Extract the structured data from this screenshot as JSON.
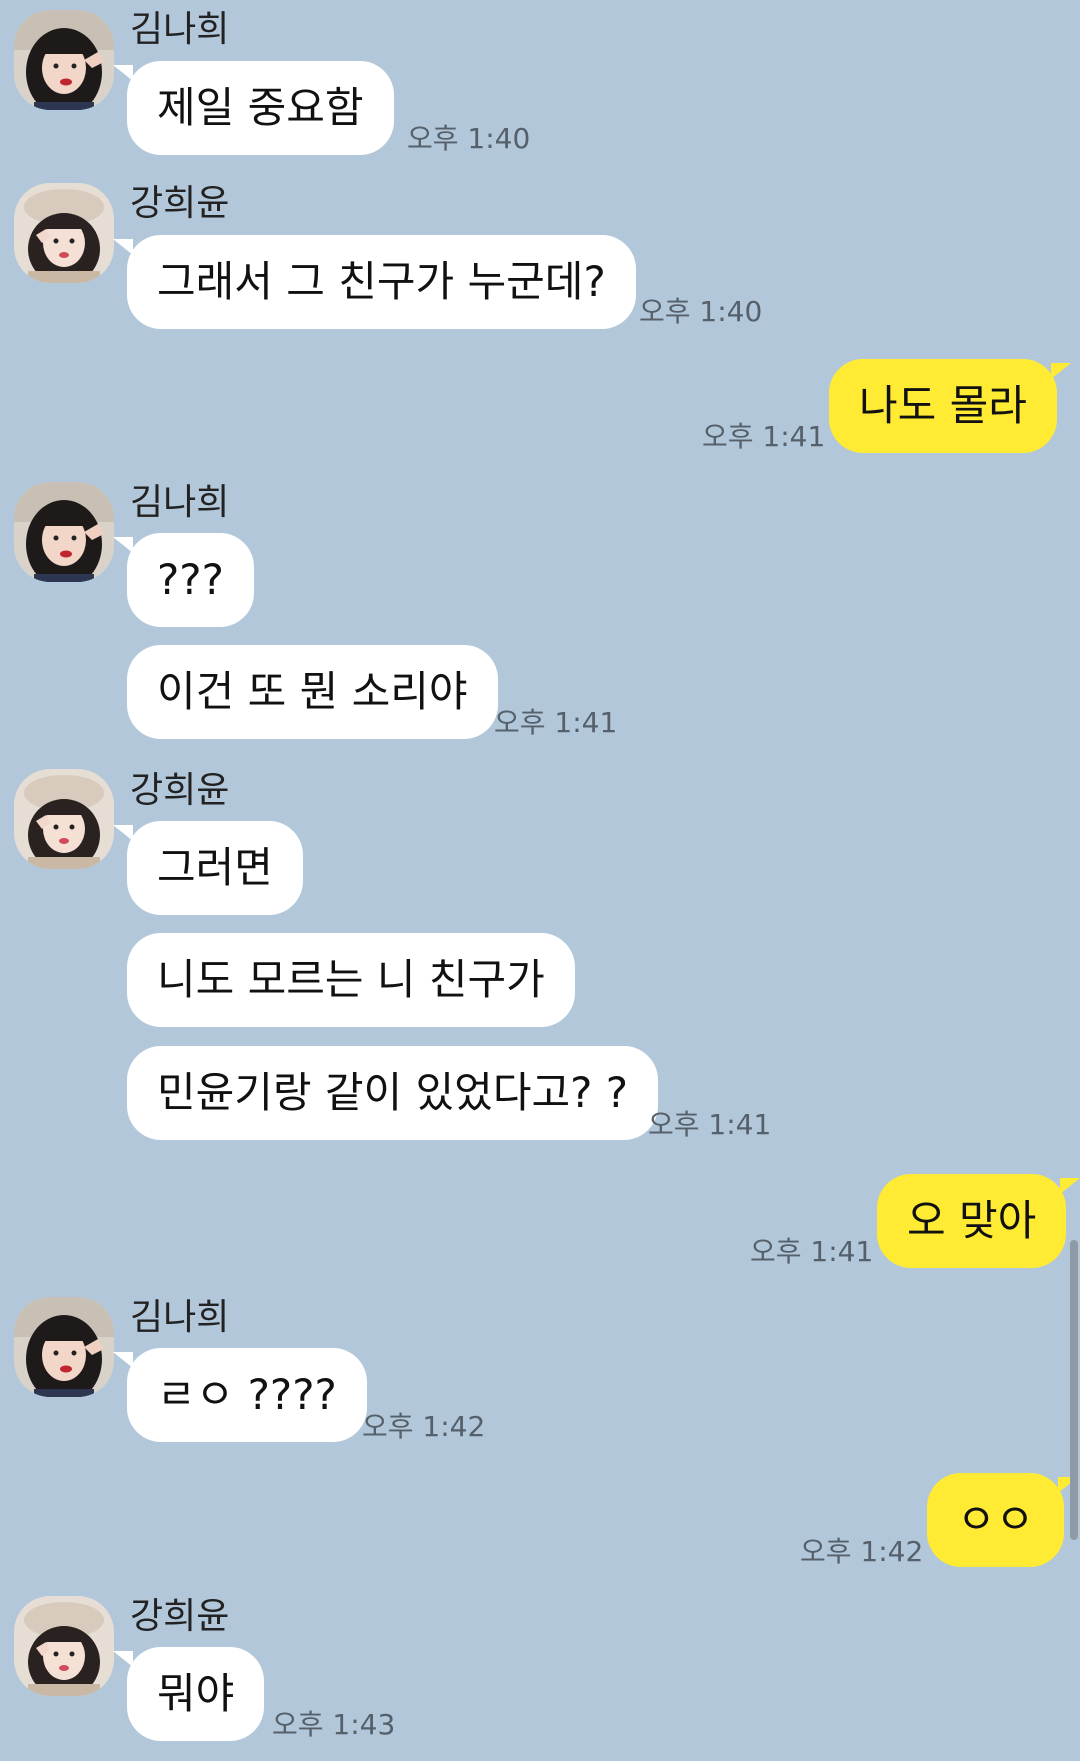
{
  "participants": {
    "kim": {
      "name": "김나희"
    },
    "kang": {
      "name": "강희윤"
    }
  },
  "colors": {
    "background": "#b2c7da",
    "incoming_bubble": "#ffffff",
    "outgoing_bubble": "#ffeb33",
    "timestamp": "#55606b"
  },
  "messages": [
    {
      "sender": "김나희",
      "text": "제일 중요함",
      "time": "오후 1:40"
    },
    {
      "sender": "강희윤",
      "text": "그래서 그 친구가 누군데?",
      "time": "오후 1:40"
    },
    {
      "sender": "me",
      "text": "나도 몰라",
      "time": "오후 1:41"
    },
    {
      "sender": "김나희",
      "text": "???",
      "time": ""
    },
    {
      "sender": "김나희",
      "text": "이건 또 뭔 소리야",
      "time": "오후 1:41"
    },
    {
      "sender": "강희윤",
      "text": "그러면",
      "time": ""
    },
    {
      "sender": "강희윤",
      "text": "니도 모르는 니 친구가",
      "time": ""
    },
    {
      "sender": "강희윤",
      "text": "민윤기랑 같이 있었다고? ?",
      "time": "오후 1:41"
    },
    {
      "sender": "me",
      "text": "오 맞아",
      "time": "오후 1:41"
    },
    {
      "sender": "김나희",
      "text": "ㄹㅇ ????",
      "time": "오후 1:42"
    },
    {
      "sender": "me",
      "text": "ㅇㅇ",
      "time": "오후 1:42"
    },
    {
      "sender": "강희윤",
      "text": "뭐야",
      "time": "오후 1:43"
    }
  ]
}
